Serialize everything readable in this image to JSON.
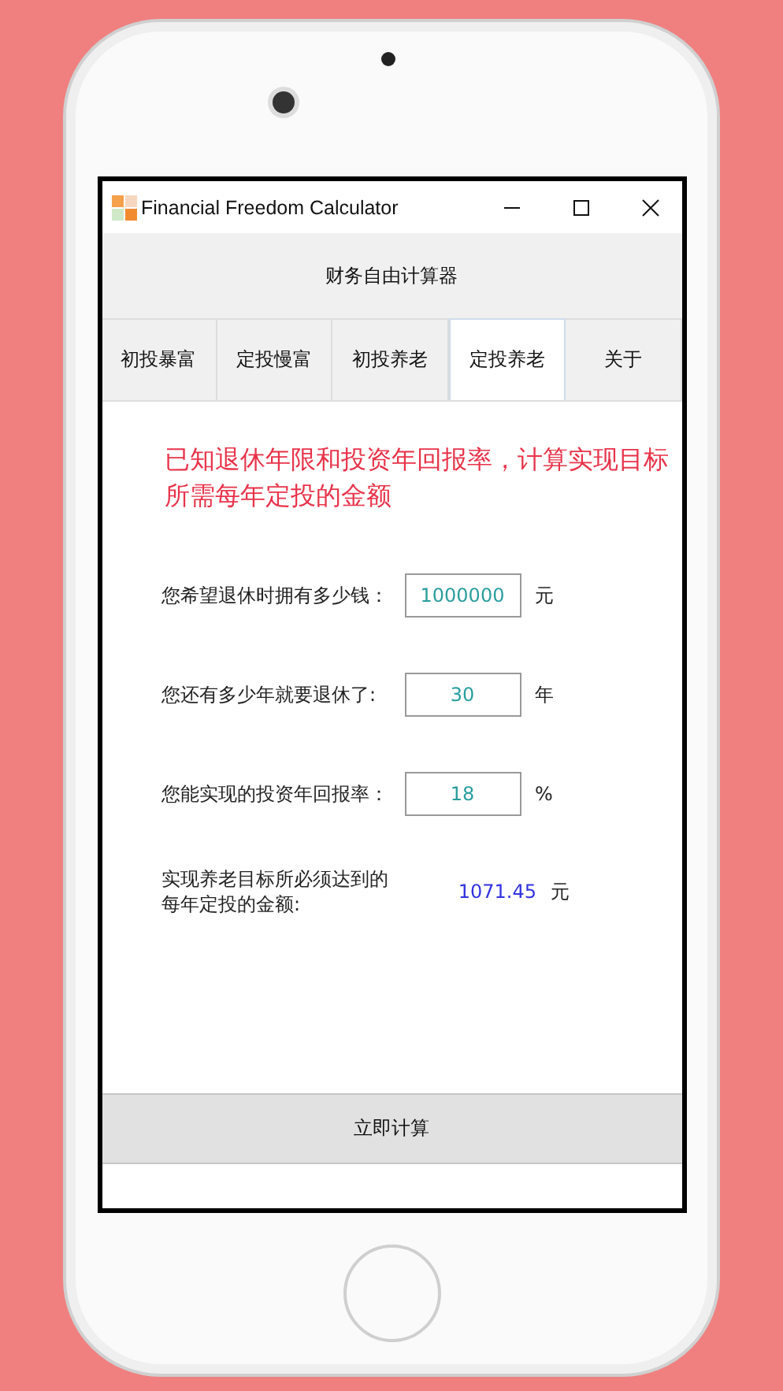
{
  "window": {
    "title": "Financial Freedom Calculator"
  },
  "header": {
    "title": "财务自由计算器"
  },
  "tabs": [
    {
      "label": "初投暴富",
      "selected": false
    },
    {
      "label": "定投慢富",
      "selected": false
    },
    {
      "label": "初投养老",
      "selected": false
    },
    {
      "label": "定投养老",
      "selected": true
    },
    {
      "label": "关于",
      "selected": false
    }
  ],
  "description": "已知退休年限和投资年回报率，计算实现目标所需每年定投的金额",
  "fields": [
    {
      "label": "您希望退休时拥有多少钱：",
      "value": "1000000",
      "unit": "元"
    },
    {
      "label": "您还有多少年就要退休了:",
      "value": "30",
      "unit": "年"
    },
    {
      "label": "您能实现的投资年回报率：",
      "value": "18",
      "unit": "%"
    }
  ],
  "result": {
    "label": "实现养老目标所必须达到的每年定投的金额:",
    "value": "1071.45",
    "unit": "元"
  },
  "button": "立即计算"
}
